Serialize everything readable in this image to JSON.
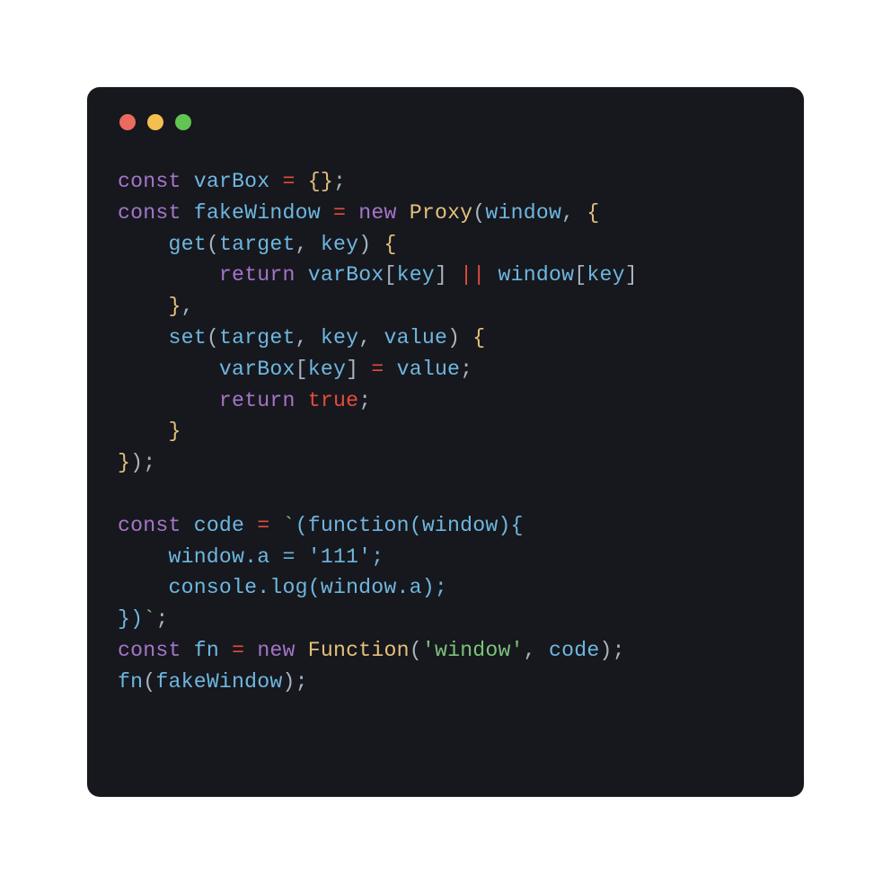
{
  "colors": {
    "background": "#16181d",
    "traffic_red": "#ec6a5e",
    "traffic_yellow": "#f4bf4f",
    "traffic_green": "#61c554",
    "keyword": "#a574c9",
    "variable": "#6fb6e0",
    "operator": "#e64c3c",
    "brace_class": "#e5c07b",
    "default": "#a8b3c1",
    "string_green": "#7cc379"
  },
  "code": {
    "tokens": [
      [
        [
          "kw",
          "const"
        ],
        [
          "punc",
          " "
        ],
        [
          "var",
          "varBox"
        ],
        [
          "punc",
          " "
        ],
        [
          "op",
          "="
        ],
        [
          "punc",
          " "
        ],
        [
          "brace",
          "{}"
        ],
        [
          "punc",
          ";"
        ]
      ],
      [
        [
          "kw",
          "const"
        ],
        [
          "punc",
          " "
        ],
        [
          "var",
          "fakeWindow"
        ],
        [
          "punc",
          " "
        ],
        [
          "op",
          "="
        ],
        [
          "punc",
          " "
        ],
        [
          "kw",
          "new"
        ],
        [
          "punc",
          " "
        ],
        [
          "class",
          "Proxy"
        ],
        [
          "punc",
          "("
        ],
        [
          "var",
          "window"
        ],
        [
          "punc",
          ", "
        ],
        [
          "brace",
          "{"
        ]
      ],
      [
        [
          "punc",
          "    "
        ],
        [
          "fn",
          "get"
        ],
        [
          "punc",
          "("
        ],
        [
          "var",
          "target"
        ],
        [
          "punc",
          ", "
        ],
        [
          "var",
          "key"
        ],
        [
          "punc",
          ") "
        ],
        [
          "brace",
          "{"
        ]
      ],
      [
        [
          "punc",
          "        "
        ],
        [
          "kw",
          "return"
        ],
        [
          "punc",
          " "
        ],
        [
          "var",
          "varBox"
        ],
        [
          "punc",
          "["
        ],
        [
          "var",
          "key"
        ],
        [
          "punc",
          "] "
        ],
        [
          "op",
          "||"
        ],
        [
          "punc",
          " "
        ],
        [
          "var",
          "window"
        ],
        [
          "punc",
          "["
        ],
        [
          "var",
          "key"
        ],
        [
          "punc",
          "]"
        ]
      ],
      [
        [
          "punc",
          "    "
        ],
        [
          "brace",
          "}"
        ],
        [
          "punc",
          ","
        ]
      ],
      [
        [
          "punc",
          "    "
        ],
        [
          "fn",
          "set"
        ],
        [
          "punc",
          "("
        ],
        [
          "var",
          "target"
        ],
        [
          "punc",
          ", "
        ],
        [
          "var",
          "key"
        ],
        [
          "punc",
          ", "
        ],
        [
          "var",
          "value"
        ],
        [
          "punc",
          ") "
        ],
        [
          "brace",
          "{"
        ]
      ],
      [
        [
          "punc",
          "        "
        ],
        [
          "var",
          "varBox"
        ],
        [
          "punc",
          "["
        ],
        [
          "var",
          "key"
        ],
        [
          "punc",
          "] "
        ],
        [
          "op",
          "="
        ],
        [
          "punc",
          " "
        ],
        [
          "var",
          "value"
        ],
        [
          "punc",
          ";"
        ]
      ],
      [
        [
          "punc",
          "        "
        ],
        [
          "kw",
          "return"
        ],
        [
          "punc",
          " "
        ],
        [
          "bool",
          "true"
        ],
        [
          "punc",
          ";"
        ]
      ],
      [
        [
          "punc",
          "    "
        ],
        [
          "brace",
          "}"
        ]
      ],
      [
        [
          "brace",
          "}"
        ],
        [
          "punc",
          ");"
        ]
      ],
      [],
      [
        [
          "kw",
          "const"
        ],
        [
          "punc",
          " "
        ],
        [
          "var",
          "code"
        ],
        [
          "punc",
          " "
        ],
        [
          "op",
          "="
        ],
        [
          "punc",
          " "
        ],
        [
          "backtk",
          "`"
        ],
        [
          "str",
          "(function(window){"
        ]
      ],
      [
        [
          "str",
          "    window.a = '111';"
        ]
      ],
      [
        [
          "str",
          "    console.log(window.a);"
        ]
      ],
      [
        [
          "str",
          "})"
        ],
        [
          "backtk",
          "`"
        ],
        [
          "punc",
          ";"
        ]
      ],
      [
        [
          "kw",
          "const"
        ],
        [
          "punc",
          " "
        ],
        [
          "var",
          "fn"
        ],
        [
          "punc",
          " "
        ],
        [
          "op",
          "="
        ],
        [
          "punc",
          " "
        ],
        [
          "kw",
          "new"
        ],
        [
          "punc",
          " "
        ],
        [
          "class",
          "Function"
        ],
        [
          "punc",
          "("
        ],
        [
          "strlit",
          "'window'"
        ],
        [
          "punc",
          ", "
        ],
        [
          "var",
          "code"
        ],
        [
          "punc",
          ");"
        ]
      ],
      [
        [
          "fn",
          "fn"
        ],
        [
          "punc",
          "("
        ],
        [
          "var",
          "fakeWindow"
        ],
        [
          "punc",
          ");"
        ]
      ]
    ]
  }
}
